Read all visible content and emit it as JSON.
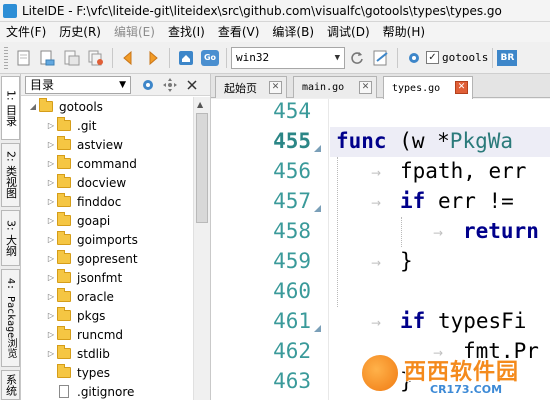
{
  "window": {
    "title": "LiteIDE - F:\\vfc\\liteide-git\\liteidex\\src\\github.com\\visualfc\\gotools\\types\\types.go"
  },
  "menu": {
    "items": [
      {
        "label": "文件(F)",
        "disabled": false
      },
      {
        "label": "历史(R)",
        "disabled": false
      },
      {
        "label": "编辑(E)",
        "disabled": true
      },
      {
        "label": "查找(I)",
        "disabled": false
      },
      {
        "label": "查看(V)",
        "disabled": false
      },
      {
        "label": "编译(B)",
        "disabled": false
      },
      {
        "label": "调试(D)",
        "disabled": false
      },
      {
        "label": "帮助(H)",
        "disabled": false
      }
    ]
  },
  "toolbar": {
    "env_value": "win32",
    "gotools_label": "gotools",
    "gotools_checked": true,
    "go_icon_text": "Go",
    "br_icon_text": "BR"
  },
  "side_tabs": [
    {
      "label": "1: 目录",
      "active": true
    },
    {
      "label": "2: 类视图",
      "active": false
    },
    {
      "label": "3: 大纲",
      "active": false
    },
    {
      "label": "4: Package浏览",
      "active": false
    },
    {
      "label": "系统",
      "active": false
    }
  ],
  "file_pane": {
    "combo_value": "目录",
    "tree": [
      {
        "name": "gotools",
        "type": "folder",
        "depth": 0,
        "expanded": true
      },
      {
        "name": ".git",
        "type": "folder",
        "depth": 1,
        "expanded": false
      },
      {
        "name": "astview",
        "type": "folder",
        "depth": 1,
        "expanded": false
      },
      {
        "name": "command",
        "type": "folder",
        "depth": 1,
        "expanded": false
      },
      {
        "name": "docview",
        "type": "folder",
        "depth": 1,
        "expanded": false
      },
      {
        "name": "finddoc",
        "type": "folder",
        "depth": 1,
        "expanded": false
      },
      {
        "name": "goapi",
        "type": "folder",
        "depth": 1,
        "expanded": false
      },
      {
        "name": "goimports",
        "type": "folder",
        "depth": 1,
        "expanded": false
      },
      {
        "name": "gopresent",
        "type": "folder",
        "depth": 1,
        "expanded": false
      },
      {
        "name": "jsonfmt",
        "type": "folder",
        "depth": 1,
        "expanded": false
      },
      {
        "name": "oracle",
        "type": "folder",
        "depth": 1,
        "expanded": false
      },
      {
        "name": "pkgs",
        "type": "folder",
        "depth": 1,
        "expanded": false
      },
      {
        "name": "runcmd",
        "type": "folder",
        "depth": 1,
        "expanded": false
      },
      {
        "name": "stdlib",
        "type": "folder",
        "depth": 1,
        "expanded": false
      },
      {
        "name": "types",
        "type": "folder",
        "depth": 1,
        "expanded": false
      },
      {
        "name": ".gitignore",
        "type": "file",
        "depth": 1,
        "expanded": false
      }
    ]
  },
  "editor_tabs": [
    {
      "label": "起始页",
      "active": false
    },
    {
      "label": "main.go",
      "active": false
    },
    {
      "label": "types.go",
      "active": true
    }
  ],
  "editor": {
    "current_line": 455,
    "lines": [
      {
        "n": 454,
        "tokens": []
      },
      {
        "n": 455,
        "tokens": [
          {
            "t": "func",
            "c": "kw"
          },
          {
            "t": " (w *",
            "c": ""
          },
          {
            "t": "PkgWa",
            "c": "ty"
          }
        ]
      },
      {
        "n": 456,
        "tokens": [
          {
            "t": "fpath, err",
            "c": ""
          }
        ]
      },
      {
        "n": 457,
        "tokens": [
          {
            "t": "if",
            "c": "kw"
          },
          {
            "t": " err != ",
            "c": ""
          }
        ]
      },
      {
        "n": 458,
        "tokens": [
          {
            "t": "return",
            "c": "kw"
          }
        ]
      },
      {
        "n": 459,
        "tokens": [
          {
            "t": "}",
            "c": ""
          }
        ]
      },
      {
        "n": 460,
        "tokens": []
      },
      {
        "n": 461,
        "tokens": [
          {
            "t": "if",
            "c": "kw"
          },
          {
            "t": " typesFi",
            "c": ""
          }
        ]
      },
      {
        "n": 462,
        "tokens": [
          {
            "t": "fmt.Pr",
            "c": ""
          }
        ]
      },
      {
        "n": 463,
        "tokens": [
          {
            "t": "}",
            "c": ""
          }
        ]
      }
    ]
  },
  "watermark": {
    "brand": "西西软件园",
    "domain": "CR173.COM"
  },
  "colors": {
    "accent": "#2d8ed6",
    "line_number": "#3a9a9a",
    "keyword": "#00008b",
    "type": "#2a7a7a",
    "active_tab_close": "#e05f37"
  }
}
